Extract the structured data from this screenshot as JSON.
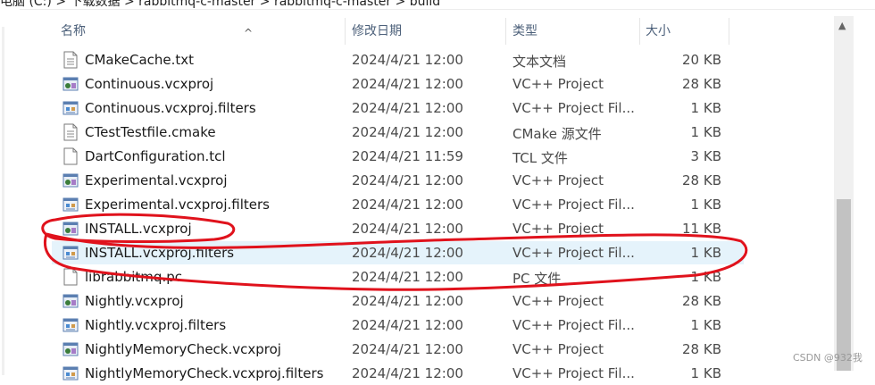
{
  "breadcrumb": "电脑 (C:)  >  下载数据  >  rabbitmq-c-master  >  rabbitmq-c-master  >  build",
  "columns": {
    "name": "名称",
    "date": "修改日期",
    "type": "类型",
    "size": "大小"
  },
  "files": [
    {
      "name": "CMakeCache.txt",
      "date": "2024/4/21 12:00",
      "type": "文本文档",
      "size": "20 KB",
      "icon": "text-file-icon"
    },
    {
      "name": "Continuous.vcxproj",
      "date": "2024/4/21 12:00",
      "type": "VC++ Project",
      "size": "28 KB",
      "icon": "vcxproj-icon"
    },
    {
      "name": "Continuous.vcxproj.filters",
      "date": "2024/4/21 12:00",
      "type": "VC++ Project Fil...",
      "size": "1 KB",
      "icon": "filters-icon"
    },
    {
      "name": "CTestTestfile.cmake",
      "date": "2024/4/21 12:00",
      "type": "CMake 源文件",
      "size": "1 KB",
      "icon": "text-file-icon"
    },
    {
      "name": "DartConfiguration.tcl",
      "date": "2024/4/21 11:59",
      "type": "TCL 文件",
      "size": "3 KB",
      "icon": "blank-file-icon"
    },
    {
      "name": "Experimental.vcxproj",
      "date": "2024/4/21 12:00",
      "type": "VC++ Project",
      "size": "28 KB",
      "icon": "vcxproj-icon"
    },
    {
      "name": "Experimental.vcxproj.filters",
      "date": "2024/4/21 12:00",
      "type": "VC++ Project Fil...",
      "size": "1 KB",
      "icon": "filters-icon"
    },
    {
      "name": "INSTALL.vcxproj",
      "date": "2024/4/21 12:00",
      "type": "VC++ Project",
      "size": "11 KB",
      "icon": "vcxproj-icon"
    },
    {
      "name": "INSTALL.vcxproj.filters",
      "date": "2024/4/21 12:00",
      "type": "VC++ Project Fil...",
      "size": "1 KB",
      "icon": "filters-icon",
      "selected": true
    },
    {
      "name": "librabbitmq.pc",
      "date": "2024/4/21 12:00",
      "type": "PC 文件",
      "size": "1 KB",
      "icon": "blank-file-icon"
    },
    {
      "name": "Nightly.vcxproj",
      "date": "2024/4/21 12:00",
      "type": "VC++ Project",
      "size": "28 KB",
      "icon": "vcxproj-icon"
    },
    {
      "name": "Nightly.vcxproj.filters",
      "date": "2024/4/21 12:00",
      "type": "VC++ Project Fil...",
      "size": "1 KB",
      "icon": "filters-icon"
    },
    {
      "name": "NightlyMemoryCheck.vcxproj",
      "date": "2024/4/21 12:00",
      "type": "VC++ Project",
      "size": "28 KB",
      "icon": "vcxproj-icon"
    },
    {
      "name": "NightlyMemoryCheck.vcxproj.filters",
      "date": "2024/4/21 12:00",
      "type": "VC++ Project Fil...",
      "size": "1 KB",
      "icon": "filters-icon"
    }
  ],
  "annotation_color": "#e0121c",
  "selected_row_color": "#e5f3fb",
  "watermark": "CSDN @932我"
}
